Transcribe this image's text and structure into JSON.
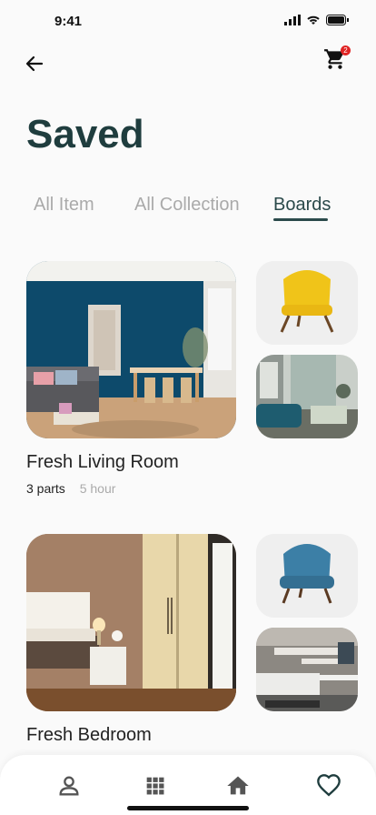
{
  "status_bar": {
    "time": "9:41"
  },
  "header": {
    "title": "Saved",
    "cart_badge": "2"
  },
  "tabs": [
    {
      "label": "All Item",
      "active": false
    },
    {
      "label": "All Collection",
      "active": false
    },
    {
      "label": "Boards",
      "active": true
    }
  ],
  "boards": [
    {
      "name": "Fresh Living Room",
      "parts": "3 parts",
      "time": "5 hour"
    },
    {
      "name": "Fresh Bedroom"
    }
  ],
  "nav": {
    "items": [
      "profile-icon",
      "grid-icon",
      "home-icon",
      "heart-icon"
    ],
    "active": "heart-icon"
  },
  "colors": {
    "accent": "#1f3d3e",
    "badge": "#e02424",
    "muted": "#aaaaaa"
  }
}
